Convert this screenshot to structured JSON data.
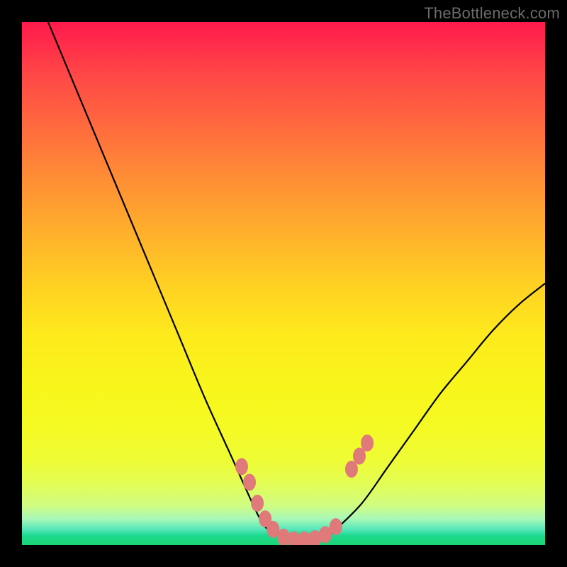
{
  "watermark": "TheBottleneck.com",
  "chart_data": {
    "type": "line",
    "title": "",
    "xlabel": "",
    "ylabel": "",
    "xlim": [
      0,
      100
    ],
    "ylim": [
      0,
      100
    ],
    "series": [
      {
        "name": "bottleneck-curve",
        "x": [
          5,
          10,
          15,
          20,
          25,
          30,
          35,
          40,
          45,
          47,
          50,
          53,
          55,
          58,
          60,
          65,
          70,
          75,
          80,
          85,
          90,
          95,
          100
        ],
        "values": [
          100,
          88,
          76,
          64,
          52,
          40,
          28,
          17,
          6,
          3,
          1.5,
          0.8,
          0.8,
          1.5,
          3,
          8,
          15,
          22,
          29,
          35,
          41,
          46,
          50
        ]
      }
    ],
    "markers": {
      "name": "marker-dots",
      "color": "#e07a7a",
      "points": [
        {
          "x": 42,
          "y": 15
        },
        {
          "x": 43.5,
          "y": 12
        },
        {
          "x": 45,
          "y": 8
        },
        {
          "x": 46.5,
          "y": 5
        },
        {
          "x": 48,
          "y": 3
        },
        {
          "x": 50,
          "y": 1.5
        },
        {
          "x": 52,
          "y": 1
        },
        {
          "x": 54,
          "y": 1
        },
        {
          "x": 56,
          "y": 1.2
        },
        {
          "x": 58,
          "y": 2
        },
        {
          "x": 60,
          "y": 3.5
        },
        {
          "x": 63,
          "y": 14.5
        },
        {
          "x": 64.5,
          "y": 17
        },
        {
          "x": 66,
          "y": 19.5
        }
      ]
    },
    "gradient_stops": [
      {
        "pos": 0,
        "color": "#ff1a4d"
      },
      {
        "pos": 50,
        "color": "#ffd023"
      },
      {
        "pos": 95,
        "color": "#a8f8b8"
      },
      {
        "pos": 100,
        "color": "#1bd473"
      }
    ]
  }
}
